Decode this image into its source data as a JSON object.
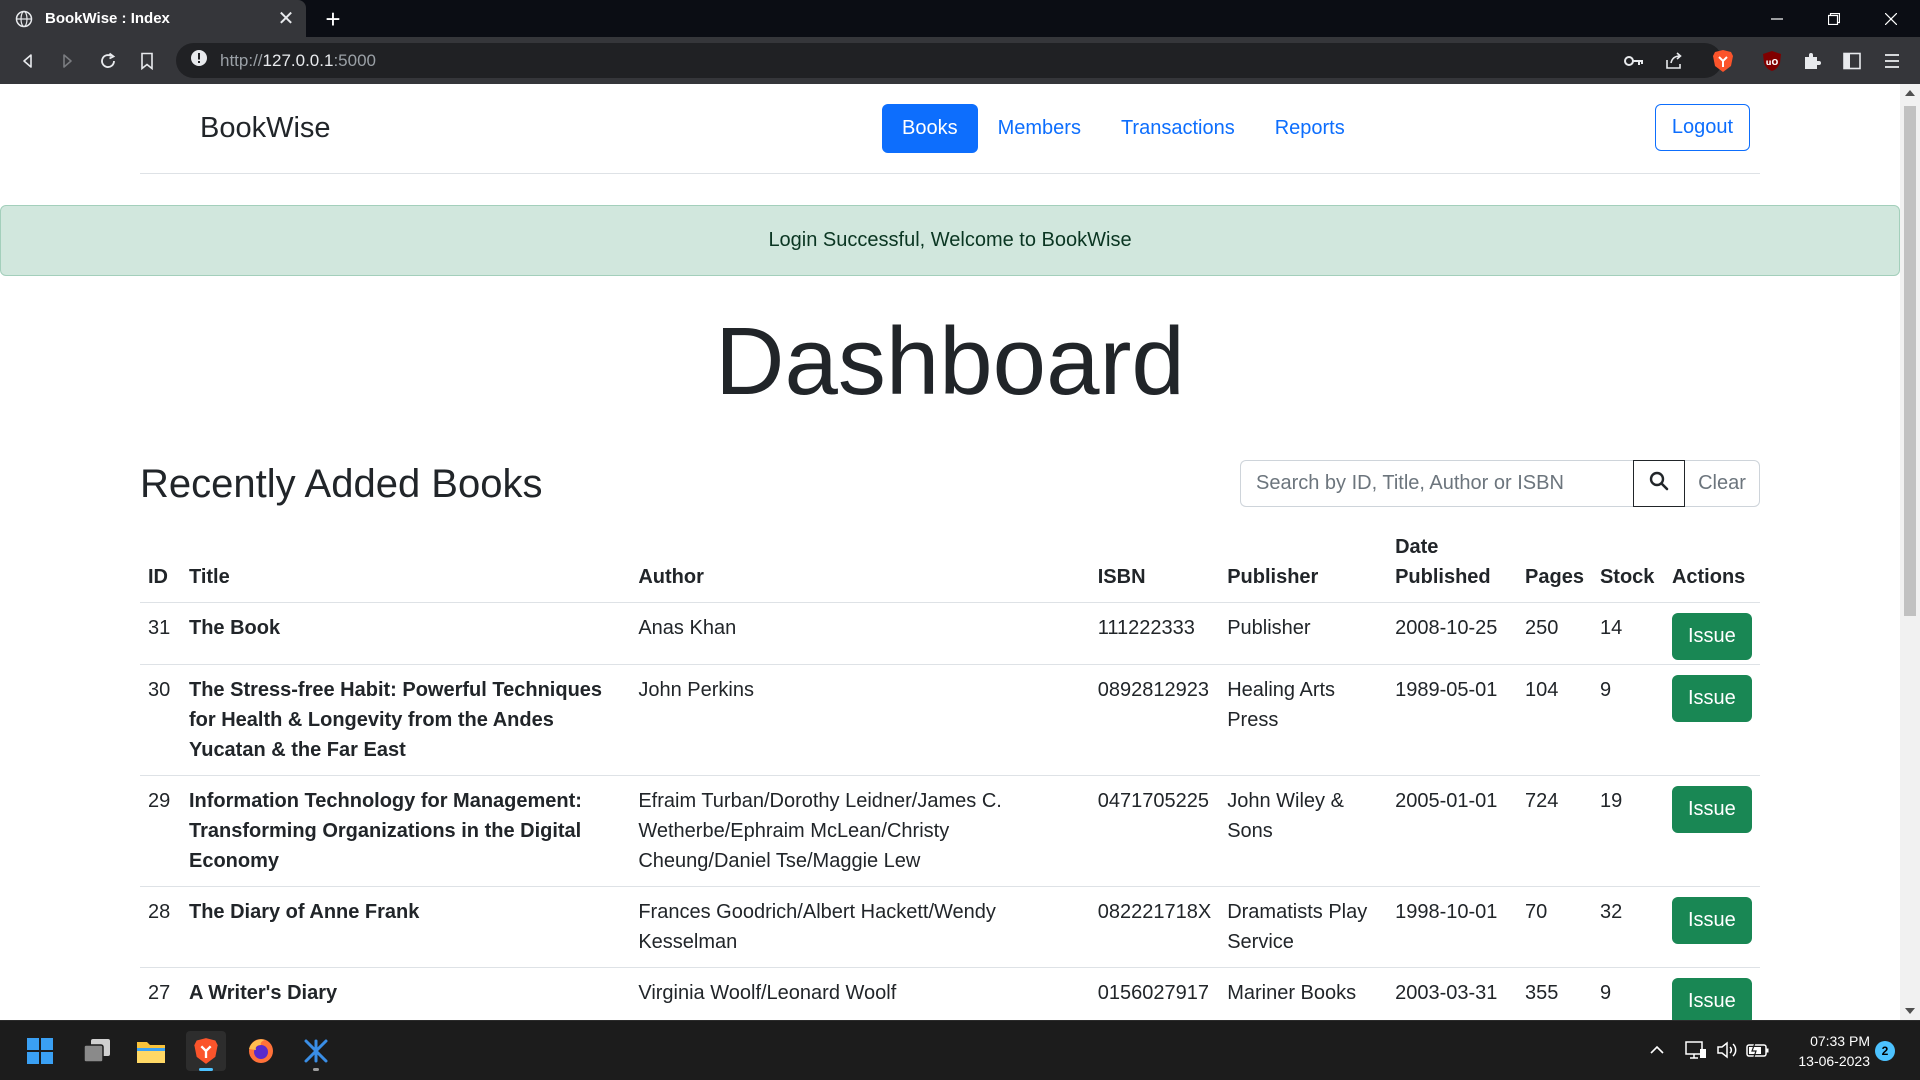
{
  "browser": {
    "tab_title": "BookWise : Index",
    "tab_close": "✕",
    "new_tab": "+",
    "url_scheme": "http://",
    "url_host": "127.0.0.1",
    "url_port": ":5000"
  },
  "navbar": {
    "brand": "BookWise",
    "links": [
      {
        "label": "Books",
        "active": true
      },
      {
        "label": "Members",
        "active": false
      },
      {
        "label": "Transactions",
        "active": false
      },
      {
        "label": "Reports",
        "active": false
      }
    ],
    "logout_label": "Logout"
  },
  "alert": {
    "message": "Login Successful, Welcome to BookWise"
  },
  "page": {
    "title": "Dashboard",
    "section_title": "Recently Added Books"
  },
  "search": {
    "placeholder": "Search by ID, Title, Author or ISBN",
    "value": "",
    "clear_label": "Clear"
  },
  "table": {
    "headers": [
      "ID",
      "Title",
      "Author",
      "ISBN",
      "Publisher",
      "Date Published",
      "Pages",
      "Stock",
      "Actions"
    ],
    "action_label": "Issue",
    "rows": [
      {
        "id": "31",
        "title": "The Book",
        "author": "Anas Khan",
        "isbn": "111222333",
        "publisher": "Publisher",
        "date": "2008-10-25",
        "pages": "250",
        "stock": "14"
      },
      {
        "id": "30",
        "title": "The Stress-free Habit: Powerful Techniques for Health & Longevity from the Andes Yucatan & the Far East",
        "author": "John Perkins",
        "isbn": "0892812923",
        "publisher": "Healing Arts Press",
        "date": "1989-05-01",
        "pages": "104",
        "stock": "9"
      },
      {
        "id": "29",
        "title": "Information Technology for Management: Transforming Organizations in the Digital Economy",
        "author": "Efraim Turban/Dorothy Leidner/James C. Wetherbe/Ephraim McLean/Christy Cheung/Daniel Tse/Maggie Lew",
        "isbn": "0471705225",
        "publisher": "John Wiley & Sons",
        "date": "2005-01-01",
        "pages": "724",
        "stock": "19"
      },
      {
        "id": "28",
        "title": "The Diary of Anne Frank",
        "author": "Frances Goodrich/Albert Hackett/Wendy Kesselman",
        "isbn": "082221718X",
        "publisher": "Dramatists Play Service",
        "date": "1998-10-01",
        "pages": "70",
        "stock": "32"
      },
      {
        "id": "27",
        "title": "A Writer's Diary",
        "author": "Virginia Woolf/Leonard Woolf",
        "isbn": "0156027917",
        "publisher": "Mariner Books",
        "date": "2003-03-31",
        "pages": "355",
        "stock": "9"
      }
    ]
  },
  "taskbar": {
    "time": "07:33 PM",
    "date": "13-06-2023",
    "notification_count": "2"
  },
  "colors": {
    "primary": "#0d6efd",
    "success": "#198754",
    "alert_bg": "#d1e7dd",
    "text": "#212529"
  }
}
